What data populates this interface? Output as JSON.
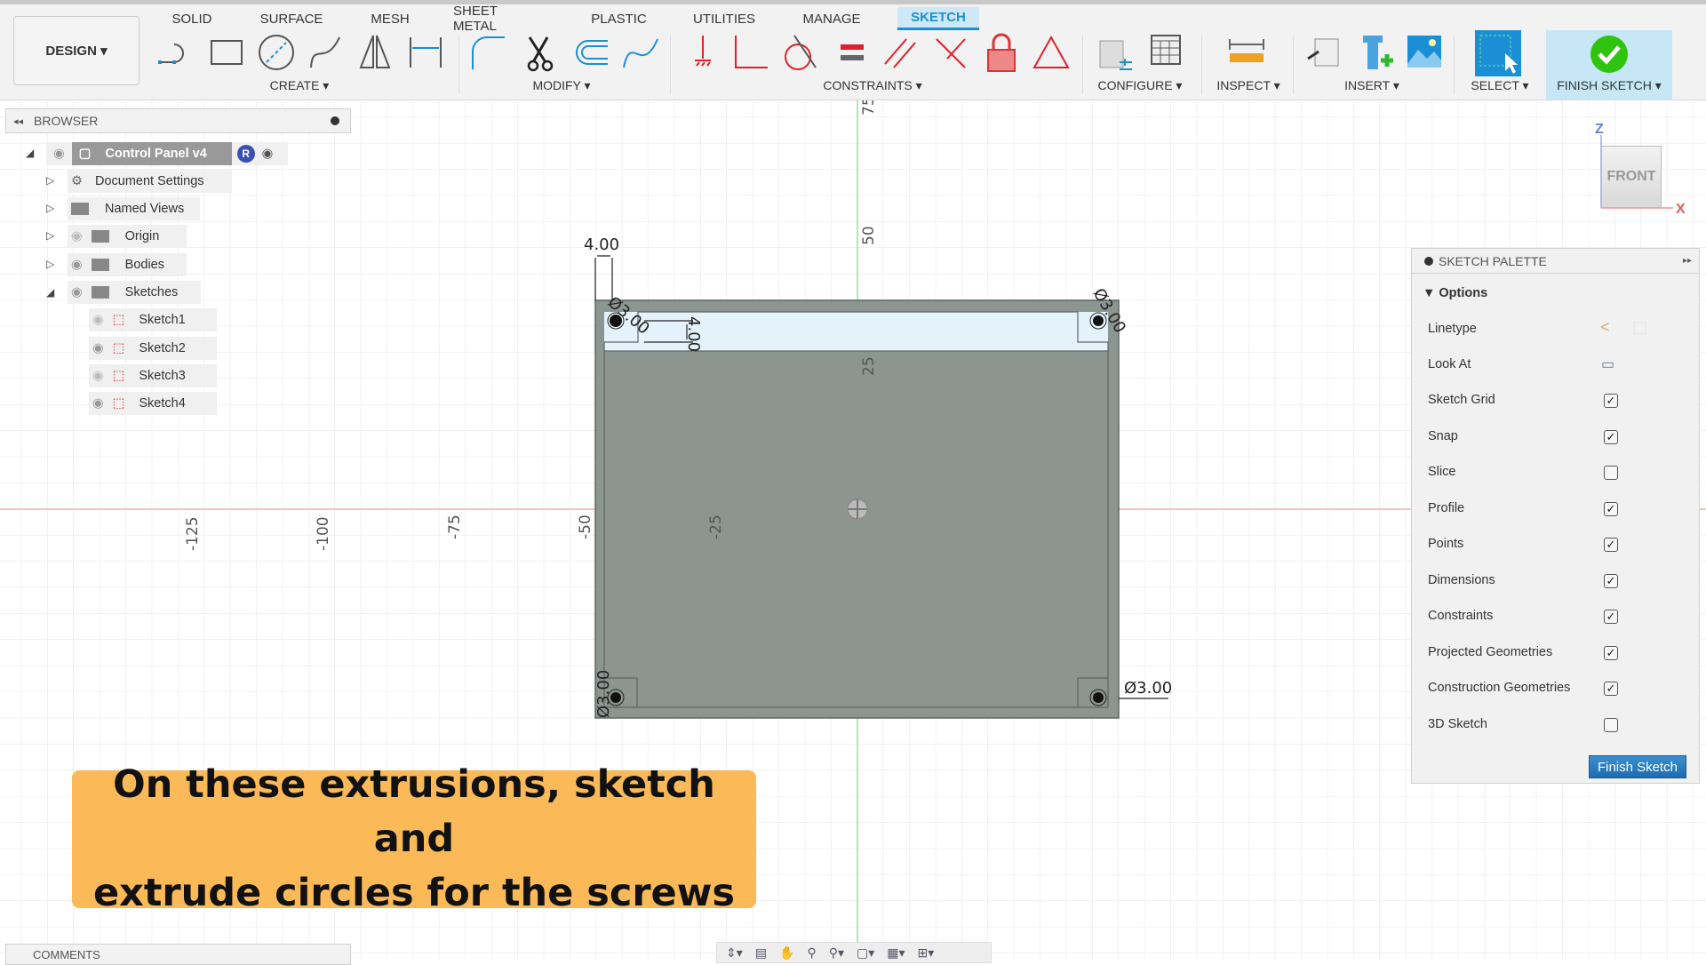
{
  "toolbar": {
    "workspace": "DESIGN",
    "tabs": [
      {
        "label": "SOLID"
      },
      {
        "label": "SURFACE"
      },
      {
        "label": "MESH"
      },
      {
        "label": "SHEET METAL"
      },
      {
        "label": "PLASTIC"
      },
      {
        "label": "UTILITIES"
      },
      {
        "label": "MANAGE"
      },
      {
        "label": "SKETCH",
        "active": true
      }
    ],
    "groups": {
      "create": "CREATE ▾",
      "modify": "MODIFY ▾",
      "constraints": "CONSTRAINTS ▾",
      "configure": "CONFIGURE ▾",
      "inspect": "INSPECT ▾",
      "insert": "INSERT ▾",
      "select": "SELECT ▾",
      "finish": "FINISH SKETCH ▾"
    },
    "accent": "#1b8fd6"
  },
  "browser": {
    "title": "BROWSER",
    "root": "Control Panel v4",
    "items": [
      {
        "label": "Document Settings"
      },
      {
        "label": "Named Views"
      },
      {
        "label": "Origin",
        "visible": false
      },
      {
        "label": "Bodies",
        "visible": true
      },
      {
        "label": "Sketches",
        "visible": true
      }
    ],
    "sketches": [
      {
        "label": "Sketch1",
        "visible": false
      },
      {
        "label": "Sketch2",
        "visible": true
      },
      {
        "label": "Sketch3",
        "visible": false
      },
      {
        "label": "Sketch4",
        "visible": true
      }
    ]
  },
  "canvas": {
    "axis_labels_x": [
      "-125",
      "-100",
      "-75",
      "-50",
      "-25"
    ],
    "axis_labels_y": [
      "50",
      "25",
      "75"
    ],
    "dimensions": {
      "top_width": "4.00",
      "inner_height": "4.00",
      "hole_tl": "Ø3.00",
      "hole_tr": "Ø3.00",
      "hole_bl": "Ø3.00",
      "hole_br": "Ø3.00"
    },
    "viewcube": {
      "face": "FRONT",
      "axis_z": "Z",
      "axis_x": "X"
    }
  },
  "palette": {
    "title": "SKETCH PALETTE",
    "section": "Options",
    "linetype": "Linetype",
    "look_at": "Look At",
    "options": [
      {
        "label": "Sketch Grid",
        "checked": true
      },
      {
        "label": "Snap",
        "checked": true
      },
      {
        "label": "Slice",
        "checked": false
      },
      {
        "label": "Profile",
        "checked": true
      },
      {
        "label": "Points",
        "checked": true
      },
      {
        "label": "Dimensions",
        "checked": true
      },
      {
        "label": "Constraints",
        "checked": true
      },
      {
        "label": "Projected Geometries",
        "checked": true
      },
      {
        "label": "Construction Geometries",
        "checked": true
      },
      {
        "label": "3D Sketch",
        "checked": false
      }
    ],
    "finish_button": "Finish Sketch"
  },
  "caption": {
    "line1": "On these extrusions, sketch and",
    "line2": "extrude circles for the screws",
    "color": "#fbb957"
  },
  "comments": {
    "title": "COMMENTS"
  }
}
